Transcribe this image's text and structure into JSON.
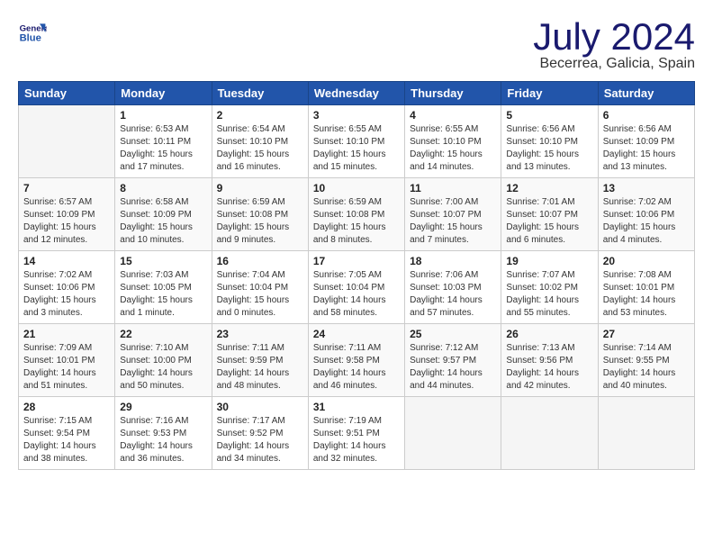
{
  "header": {
    "logo_line1": "General",
    "logo_line2": "Blue",
    "month_year": "July 2024",
    "location": "Becerrea, Galicia, Spain"
  },
  "days_of_week": [
    "Sunday",
    "Monday",
    "Tuesday",
    "Wednesday",
    "Thursday",
    "Friday",
    "Saturday"
  ],
  "weeks": [
    [
      {
        "day": "",
        "info": ""
      },
      {
        "day": "1",
        "info": "Sunrise: 6:53 AM\nSunset: 10:11 PM\nDaylight: 15 hours\nand 17 minutes."
      },
      {
        "day": "2",
        "info": "Sunrise: 6:54 AM\nSunset: 10:10 PM\nDaylight: 15 hours\nand 16 minutes."
      },
      {
        "day": "3",
        "info": "Sunrise: 6:55 AM\nSunset: 10:10 PM\nDaylight: 15 hours\nand 15 minutes."
      },
      {
        "day": "4",
        "info": "Sunrise: 6:55 AM\nSunset: 10:10 PM\nDaylight: 15 hours\nand 14 minutes."
      },
      {
        "day": "5",
        "info": "Sunrise: 6:56 AM\nSunset: 10:10 PM\nDaylight: 15 hours\nand 13 minutes."
      },
      {
        "day": "6",
        "info": "Sunrise: 6:56 AM\nSunset: 10:09 PM\nDaylight: 15 hours\nand 13 minutes."
      }
    ],
    [
      {
        "day": "7",
        "info": "Sunrise: 6:57 AM\nSunset: 10:09 PM\nDaylight: 15 hours\nand 12 minutes."
      },
      {
        "day": "8",
        "info": "Sunrise: 6:58 AM\nSunset: 10:09 PM\nDaylight: 15 hours\nand 10 minutes."
      },
      {
        "day": "9",
        "info": "Sunrise: 6:59 AM\nSunset: 10:08 PM\nDaylight: 15 hours\nand 9 minutes."
      },
      {
        "day": "10",
        "info": "Sunrise: 6:59 AM\nSunset: 10:08 PM\nDaylight: 15 hours\nand 8 minutes."
      },
      {
        "day": "11",
        "info": "Sunrise: 7:00 AM\nSunset: 10:07 PM\nDaylight: 15 hours\nand 7 minutes."
      },
      {
        "day": "12",
        "info": "Sunrise: 7:01 AM\nSunset: 10:07 PM\nDaylight: 15 hours\nand 6 minutes."
      },
      {
        "day": "13",
        "info": "Sunrise: 7:02 AM\nSunset: 10:06 PM\nDaylight: 15 hours\nand 4 minutes."
      }
    ],
    [
      {
        "day": "14",
        "info": "Sunrise: 7:02 AM\nSunset: 10:06 PM\nDaylight: 15 hours\nand 3 minutes."
      },
      {
        "day": "15",
        "info": "Sunrise: 7:03 AM\nSunset: 10:05 PM\nDaylight: 15 hours\nand 1 minute."
      },
      {
        "day": "16",
        "info": "Sunrise: 7:04 AM\nSunset: 10:04 PM\nDaylight: 15 hours\nand 0 minutes."
      },
      {
        "day": "17",
        "info": "Sunrise: 7:05 AM\nSunset: 10:04 PM\nDaylight: 14 hours\nand 58 minutes."
      },
      {
        "day": "18",
        "info": "Sunrise: 7:06 AM\nSunset: 10:03 PM\nDaylight: 14 hours\nand 57 minutes."
      },
      {
        "day": "19",
        "info": "Sunrise: 7:07 AM\nSunset: 10:02 PM\nDaylight: 14 hours\nand 55 minutes."
      },
      {
        "day": "20",
        "info": "Sunrise: 7:08 AM\nSunset: 10:01 PM\nDaylight: 14 hours\nand 53 minutes."
      }
    ],
    [
      {
        "day": "21",
        "info": "Sunrise: 7:09 AM\nSunset: 10:01 PM\nDaylight: 14 hours\nand 51 minutes."
      },
      {
        "day": "22",
        "info": "Sunrise: 7:10 AM\nSunset: 10:00 PM\nDaylight: 14 hours\nand 50 minutes."
      },
      {
        "day": "23",
        "info": "Sunrise: 7:11 AM\nSunset: 9:59 PM\nDaylight: 14 hours\nand 48 minutes."
      },
      {
        "day": "24",
        "info": "Sunrise: 7:11 AM\nSunset: 9:58 PM\nDaylight: 14 hours\nand 46 minutes."
      },
      {
        "day": "25",
        "info": "Sunrise: 7:12 AM\nSunset: 9:57 PM\nDaylight: 14 hours\nand 44 minutes."
      },
      {
        "day": "26",
        "info": "Sunrise: 7:13 AM\nSunset: 9:56 PM\nDaylight: 14 hours\nand 42 minutes."
      },
      {
        "day": "27",
        "info": "Sunrise: 7:14 AM\nSunset: 9:55 PM\nDaylight: 14 hours\nand 40 minutes."
      }
    ],
    [
      {
        "day": "28",
        "info": "Sunrise: 7:15 AM\nSunset: 9:54 PM\nDaylight: 14 hours\nand 38 minutes."
      },
      {
        "day": "29",
        "info": "Sunrise: 7:16 AM\nSunset: 9:53 PM\nDaylight: 14 hours\nand 36 minutes."
      },
      {
        "day": "30",
        "info": "Sunrise: 7:17 AM\nSunset: 9:52 PM\nDaylight: 14 hours\nand 34 minutes."
      },
      {
        "day": "31",
        "info": "Sunrise: 7:19 AM\nSunset: 9:51 PM\nDaylight: 14 hours\nand 32 minutes."
      },
      {
        "day": "",
        "info": ""
      },
      {
        "day": "",
        "info": ""
      },
      {
        "day": "",
        "info": ""
      }
    ]
  ]
}
